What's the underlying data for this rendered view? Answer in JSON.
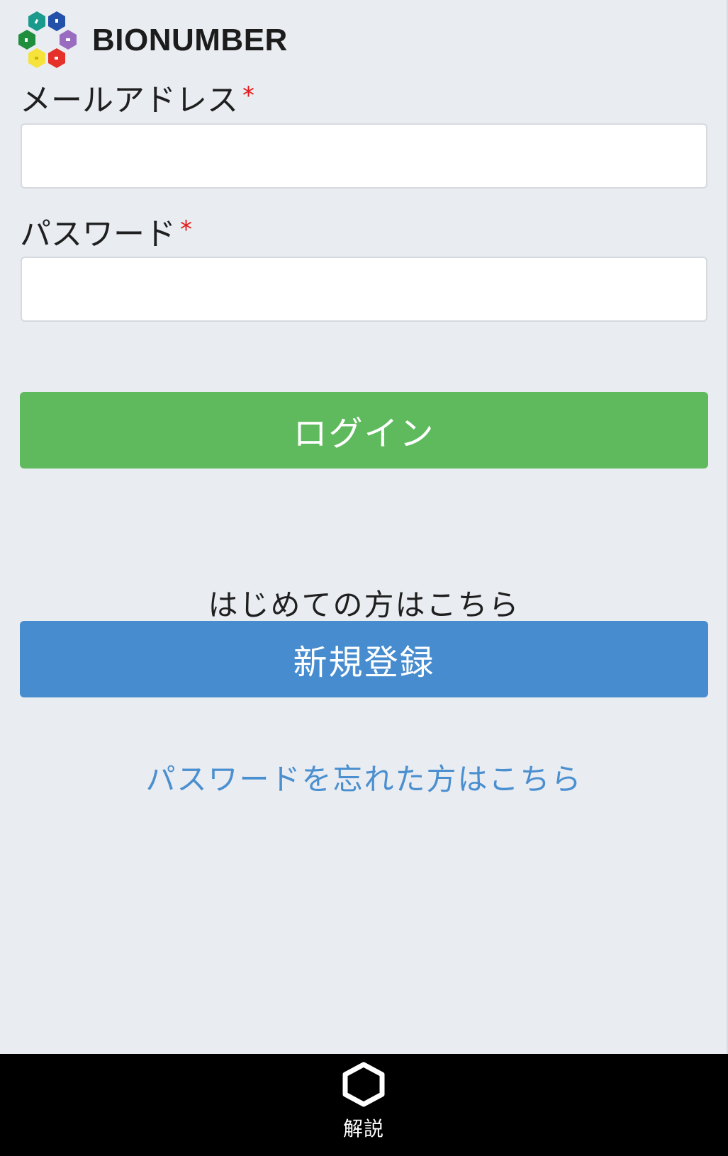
{
  "header": {
    "brand_name": "BIONUMBER",
    "logo_icon": "bionumber-hexagon-logo-icon",
    "logo_colors": [
      "#1a9a8c",
      "#2350a8",
      "#9a6cc0",
      "#e6302a",
      "#f5e23a",
      "#1f8f3e"
    ]
  },
  "form": {
    "email": {
      "label": "メールアドレス",
      "required_mark": "*",
      "value": "",
      "placeholder": ""
    },
    "password": {
      "label": "パスワード",
      "required_mark": "*",
      "value": "",
      "placeholder": ""
    },
    "login_button": "ログイン"
  },
  "register": {
    "prompt": "はじめての方はこちら",
    "button": "新規登録"
  },
  "forgot_password": {
    "link": "パスワードを忘れた方はこちら"
  },
  "tabbar": {
    "items": [
      {
        "icon": "hexagon-outline-icon",
        "label": "解説"
      }
    ]
  },
  "colors": {
    "background": "#e9ecf1",
    "login_green": "#5fba5e",
    "register_blue": "#478ccf",
    "link_blue": "#4a8fd0",
    "required_red": "#e31b1b",
    "tabbar_black": "#000000"
  }
}
